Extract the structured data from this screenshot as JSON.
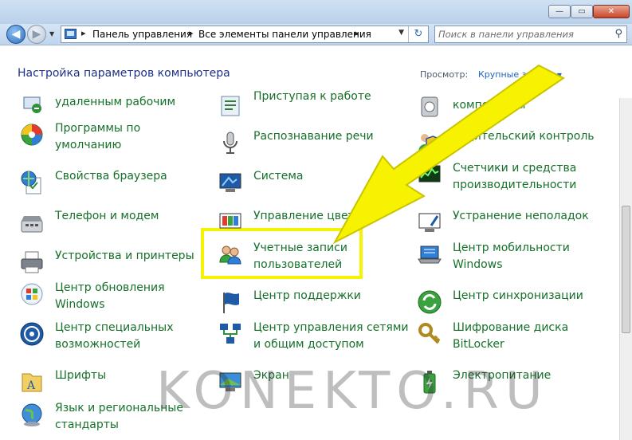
{
  "window": {
    "controls": {
      "minimize": "—",
      "maximize": "▭",
      "close": "✕"
    }
  },
  "navigation": {
    "back": "◀",
    "forward": "▶",
    "breadcrumbs": [
      "Панель управления",
      "Все элементы панели управления"
    ],
    "separator": "▸",
    "refresh": "↻",
    "search_placeholder": "Поиск в панели управления"
  },
  "header": {
    "title": "Настройка параметров компьютера",
    "view_label": "Просмотр:",
    "view_value": "Крупные значки",
    "view_arrow": "▼"
  },
  "items": [
    {
      "label": "удаленным рабочим",
      "icon": "remote-desktop-icon"
    },
    {
      "label": "Программы по\nумолчанию",
      "icon": "default-programs-icon"
    },
    {
      "label": "Свойства браузера",
      "icon": "browser-options-icon"
    },
    {
      "label": "Телефон и модем",
      "icon": "phone-modem-icon"
    },
    {
      "label": "Устройства и принтеры",
      "icon": "printer-icon"
    },
    {
      "label": "Центр обновления\nWindows",
      "icon": "windows-update-icon"
    },
    {
      "label": "Центр специальных\nвозможностей",
      "icon": "accessibility-icon"
    },
    {
      "label": "Шрифты",
      "icon": "fonts-icon"
    },
    {
      "label": "Язык и региональные\nстандарты",
      "icon": "region-globe-icon"
    },
    {
      "label": "Приступая к работе",
      "icon": "getting-started-icon"
    },
    {
      "label": "Распознавание речи",
      "icon": "microphone-icon"
    },
    {
      "label": "Система",
      "icon": "system-monitor-icon"
    },
    {
      "label": "Управление цветом",
      "icon": "color-management-icon"
    },
    {
      "label": "Учетные записи\nпользователей",
      "icon": "user-accounts-icon"
    },
    {
      "label": "Центр поддержки",
      "icon": "flag-icon"
    },
    {
      "label": "Центр управления сетями\nи общим доступом",
      "icon": "network-icon"
    },
    {
      "label": "Экран",
      "icon": "display-icon"
    },
    {
      "label": "компоненты",
      "icon": "programs-components-icon"
    },
    {
      "label": "Родительский контроль",
      "icon": "parental-control-icon"
    },
    {
      "label": "Счетчики и средства\nпроизводительности",
      "icon": "performance-icon"
    },
    {
      "label": "Устранение неполадок",
      "icon": "troubleshooting-icon"
    },
    {
      "label": "Центр мобильности\nWindows",
      "icon": "mobility-center-icon"
    },
    {
      "label": "Центр синхронизации",
      "icon": "sync-center-icon"
    },
    {
      "label": "Шифрование диска\nBitLocker",
      "icon": "bitlocker-key-icon"
    },
    {
      "label": "Электропитание",
      "icon": "power-options-icon"
    }
  ],
  "watermark": "KONEKTO.RU",
  "colors": {
    "link_green": "#16702a",
    "heading_blue": "#1e3287",
    "highlight": "#f6f200"
  }
}
